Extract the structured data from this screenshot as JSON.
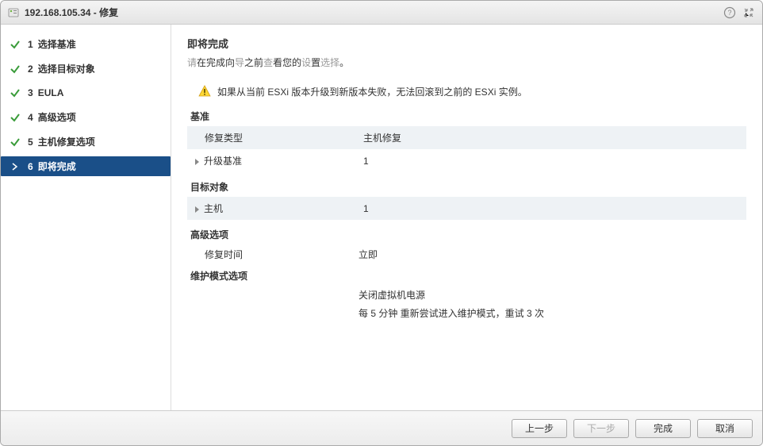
{
  "title": "192.168.105.34 - 修复",
  "steps": [
    {
      "num": "1",
      "label": "选择基准",
      "done": true
    },
    {
      "num": "2",
      "label": "选择目标对象",
      "done": true
    },
    {
      "num": "3",
      "label": "EULA",
      "done": true
    },
    {
      "num": "4",
      "label": "高级选项",
      "done": true
    },
    {
      "num": "5",
      "label": "主机修复选项",
      "done": true
    },
    {
      "num": "6",
      "label": "即将完成",
      "active": true
    }
  ],
  "content": {
    "title": "即将完成",
    "subtitle_prefix": "请",
    "subtitle_mid1": "在完成向",
    "subtitle_grey1": "导",
    "subtitle_mid2": "之前",
    "subtitle_norm2": "查",
    "subtitle_mid3": "看您的",
    "subtitle_grey2": "设",
    "subtitle_norm3": "置",
    "subtitle_grey3": "选择",
    "subtitle_end": "。",
    "warning": "如果从当前 ESXi 版本升级到新版本失败，无法回滚到之前的 ESXi 实例。",
    "sections": {
      "baseline": {
        "header": "基准",
        "rows": [
          {
            "key": "修复类型",
            "val": "主机修复",
            "expandable": false
          },
          {
            "key": "升级基准",
            "val": "1",
            "expandable": true
          }
        ]
      },
      "target": {
        "header": "目标对象",
        "rows": [
          {
            "key": "主机",
            "val": "1",
            "expandable": true
          }
        ]
      },
      "advanced": {
        "header": "高级选项",
        "rows": [
          {
            "key": "修复时间",
            "val": "立即"
          }
        ]
      },
      "maintenance": {
        "header": "维护模式选项",
        "lines": [
          "关闭虚拟机电源",
          "每 5 分钟 重新尝试进入维护模式，重试 3 次"
        ]
      }
    }
  },
  "buttons": {
    "back": "上一步",
    "next": "下一步",
    "finish": "完成",
    "cancel": "取消"
  }
}
